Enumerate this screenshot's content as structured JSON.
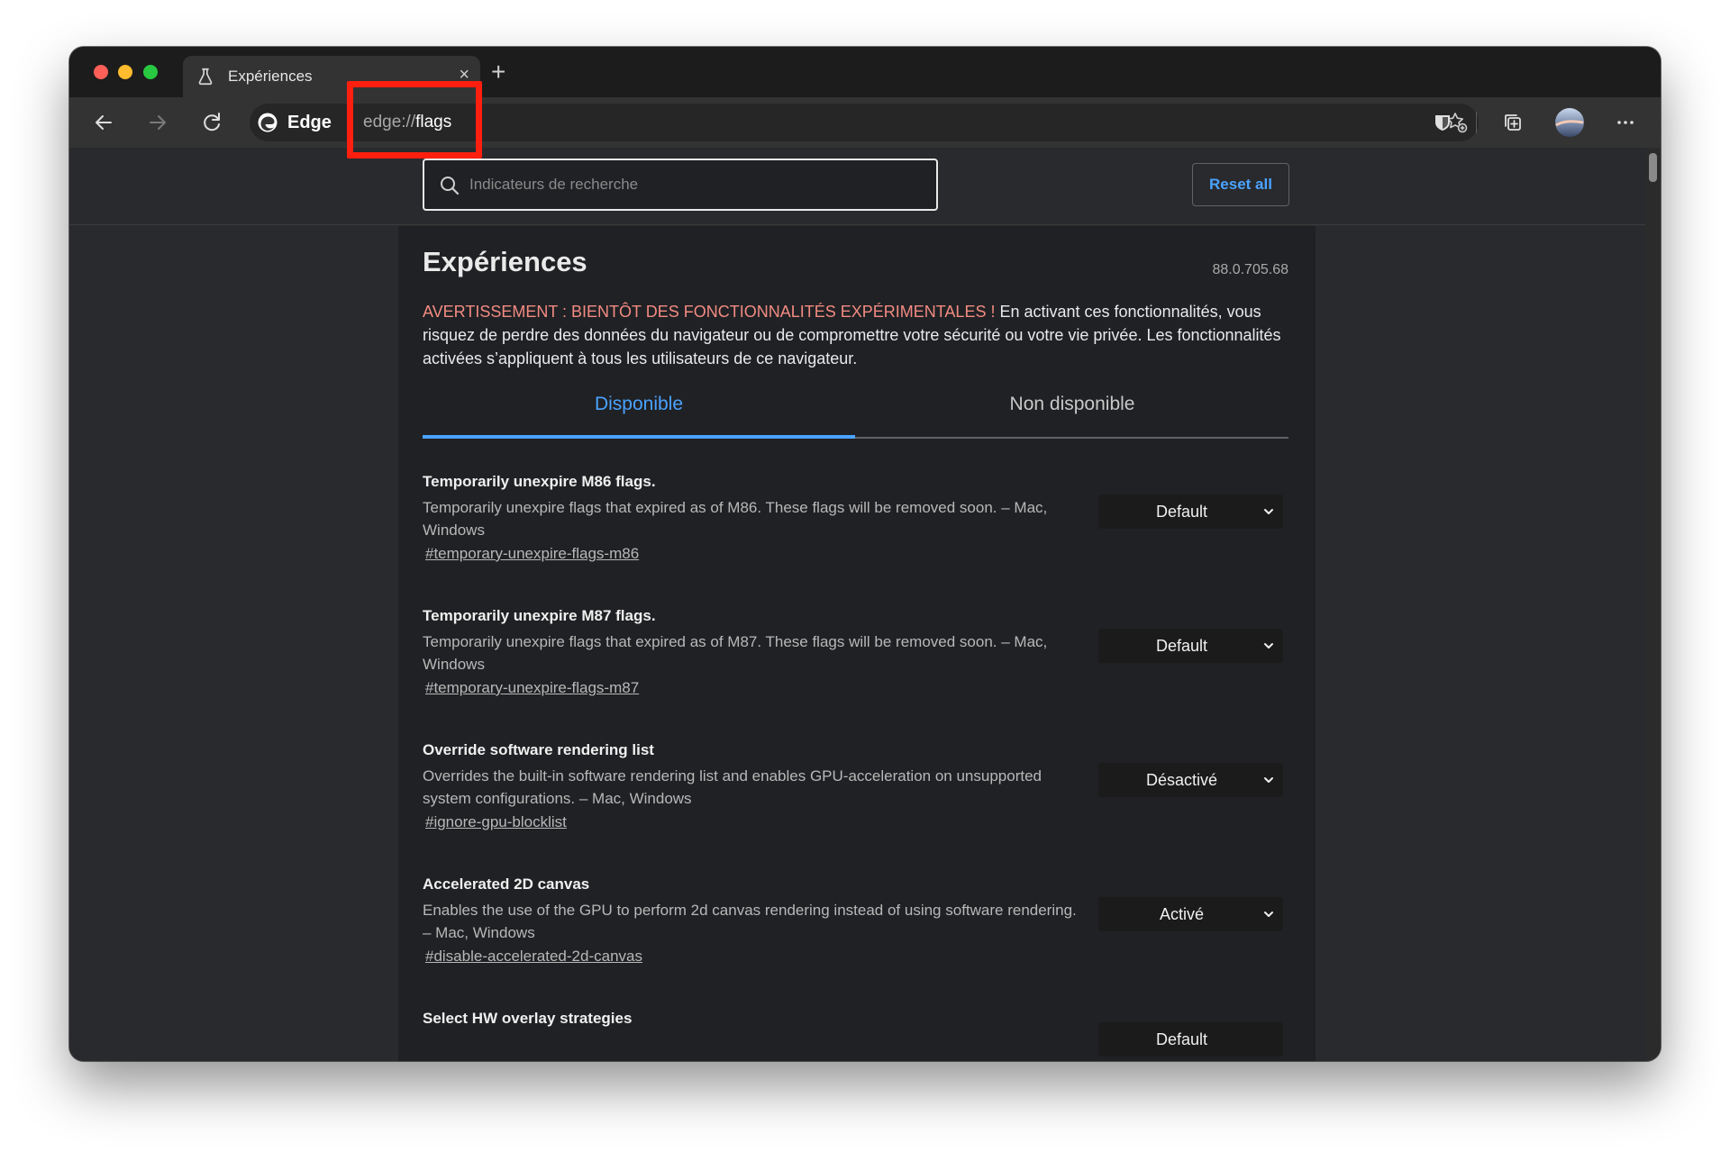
{
  "window": {
    "tab": {
      "title": "Expériences",
      "close_glyph": "×"
    },
    "new_tab_glyph": "+"
  },
  "toolbar": {
    "edge_label": "Edge",
    "url_scheme": "edge://",
    "url_path": "flags"
  },
  "search": {
    "placeholder": "Indicateurs de recherche",
    "reset_label": "Reset all"
  },
  "page": {
    "title": "Expériences",
    "version": "88.0.705.68",
    "warning_strong": "AVERTISSEMENT : BIENTÔT DES FONCTIONNALITÉS EXPÉRIMENTALES !",
    "warning_text": " En activant ces fonctionnalités, vous risquez de perdre des données du navigateur ou de compromettre votre sécurité ou votre vie privée. Les fonctionnalités activées s’appliquent à tous les utilisateurs de ce navigateur.",
    "tabs": [
      {
        "label": "Disponible",
        "active": true
      },
      {
        "label": "Non disponible",
        "active": false
      }
    ]
  },
  "flags": [
    {
      "name": "Temporarily unexpire M86 flags.",
      "description": "Temporarily unexpire flags that expired as of M86. These flags will be removed soon. – Mac, Windows",
      "link": "#temporary-unexpire-flags-m86",
      "value": "Default"
    },
    {
      "name": "Temporarily unexpire M87 flags.",
      "description": "Temporarily unexpire flags that expired as of M87. These flags will be removed soon. – Mac, Windows",
      "link": "#temporary-unexpire-flags-m87",
      "value": "Default"
    },
    {
      "name": "Override software rendering list",
      "description": "Overrides the built-in software rendering list and enables GPU-acceleration on unsupported system configurations. – Mac, Windows",
      "link": "#ignore-gpu-blocklist",
      "value": "Désactivé"
    },
    {
      "name": "Accelerated 2D canvas",
      "description": "Enables the use of the GPU to perform 2d canvas rendering instead of using software rendering. – Mac, Windows",
      "link": "#disable-accelerated-2d-canvas",
      "value": "Activé"
    },
    {
      "name": "Select HW overlay strategies",
      "description": "",
      "link": "",
      "value": "Default"
    }
  ],
  "colors": {
    "accent": "#4aa3ff",
    "warning": "#f28b82",
    "highlight": "#ff1f0f"
  }
}
